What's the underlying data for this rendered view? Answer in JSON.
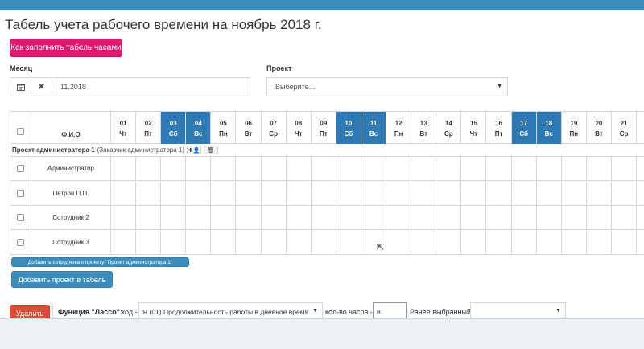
{
  "title": "Табель учета рабочего времени на ноябрь 2018 г.",
  "fill_help_button": "Как заполнить табель часами",
  "month": {
    "label": "Месяц",
    "value": "11.2018",
    "calendar_icon": "calendar-icon",
    "clear_icon": "clear-icon"
  },
  "project": {
    "label": "Проект",
    "placeholder": "Выберите..."
  },
  "table": {
    "fio_header": "Ф.И.О",
    "days": [
      {
        "d": "01",
        "w": "Чт",
        "weekend": false
      },
      {
        "d": "02",
        "w": "Пт",
        "weekend": false
      },
      {
        "d": "03",
        "w": "Сб",
        "weekend": true
      },
      {
        "d": "04",
        "w": "Вс",
        "weekend": true
      },
      {
        "d": "05",
        "w": "Пн",
        "weekend": false
      },
      {
        "d": "06",
        "w": "Вт",
        "weekend": false
      },
      {
        "d": "07",
        "w": "Ср",
        "weekend": false
      },
      {
        "d": "08",
        "w": "Чт",
        "weekend": false
      },
      {
        "d": "09",
        "w": "Пт",
        "weekend": false
      },
      {
        "d": "10",
        "w": "Сб",
        "weekend": true
      },
      {
        "d": "11",
        "w": "Вс",
        "weekend": true
      },
      {
        "d": "12",
        "w": "Пн",
        "weekend": false
      },
      {
        "d": "13",
        "w": "Вт",
        "weekend": false
      },
      {
        "d": "14",
        "w": "Ср",
        "weekend": false
      },
      {
        "d": "15",
        "w": "Чт",
        "weekend": false
      },
      {
        "d": "16",
        "w": "Пт",
        "weekend": false
      },
      {
        "d": "17",
        "w": "Сб",
        "weekend": true
      },
      {
        "d": "18",
        "w": "Вс",
        "weekend": true
      },
      {
        "d": "19",
        "w": "Пн",
        "weekend": false
      },
      {
        "d": "20",
        "w": "Вт",
        "weekend": false
      },
      {
        "d": "21",
        "w": "Ср",
        "weekend": false
      }
    ],
    "project_group": {
      "name": "Проект администратора 1",
      "customer": "(Заказчик администратора 1)",
      "add_icon": "add-user-icon",
      "delete_icon": "trash-icon"
    },
    "employees": [
      "Администратор",
      "Петров П.П.",
      "Сотрудник 2",
      "Сотрудник 3"
    ],
    "add_employee_button": "Добавить сотрудника к проекту \"Проект администратора 1\"",
    "add_project_button": "Добавить проект в табель"
  },
  "bottom": {
    "delete_button": "Удалить",
    "lasso_label": "Функция \"Лассо\":",
    "code_label": "код -",
    "code_value": "Я (01) Продолжительность работы в дневное время",
    "hours_label": "кол-во часов -",
    "hours_value": "8",
    "previous_label": "Ранее выбранный:",
    "previous_value": ""
  },
  "colors": {
    "header_bar": "#3c8dbc",
    "weekend": "#2f7ab5",
    "pink_button": "#e0196f",
    "delete_button": "#dd4b39"
  }
}
